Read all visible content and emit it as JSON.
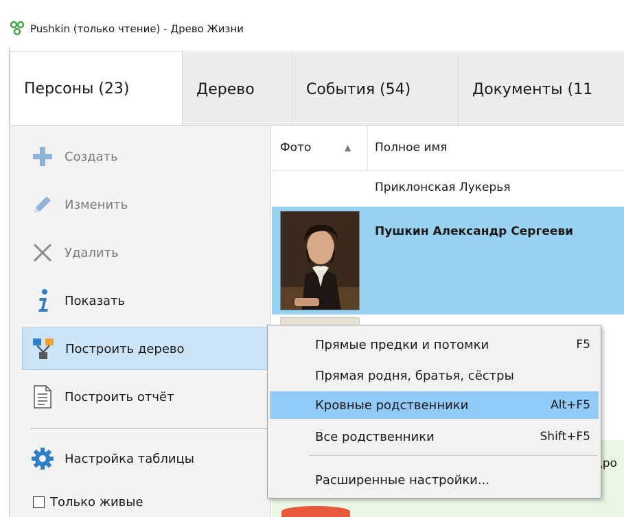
{
  "window": {
    "title": "Pushkin (только чтение) - Древо Жизни"
  },
  "tabs": [
    {
      "label": "Персоны (23)"
    },
    {
      "label": "Дерево"
    },
    {
      "label": "События (54)"
    },
    {
      "label": "Документы (11"
    }
  ],
  "sidebar": {
    "items": [
      {
        "label": "Создать",
        "icon": "plus-icon",
        "enabled": false
      },
      {
        "label": "Изменить",
        "icon": "pencil-icon",
        "enabled": false
      },
      {
        "label": "Удалить",
        "icon": "x-icon",
        "enabled": false
      },
      {
        "label": "Показать",
        "icon": "info-icon",
        "enabled": true
      },
      {
        "label": "Построить дерево",
        "icon": "tree-icon",
        "enabled": true
      },
      {
        "label": "Построить отчёт",
        "icon": "document-icon",
        "enabled": true
      },
      {
        "label": "Настройка таблицы",
        "icon": "gear-icon",
        "enabled": true
      }
    ],
    "only_living_label": "Только живые",
    "only_living_checked": false
  },
  "grid": {
    "columns": [
      {
        "label": "Фото",
        "sort": "asc"
      },
      {
        "label": "Полное имя"
      }
    ],
    "rows": [
      {
        "name": "Приклонская Лукерья"
      },
      {
        "name": "Пушкин Александр Сергееви",
        "selected": true
      },
      {
        "name": ""
      }
    ],
    "bottom_row_partial": "дро"
  },
  "context_menu": {
    "items": [
      {
        "label": "Прямые предки и потомки",
        "shortcut": "F5"
      },
      {
        "label": "Прямая родня, братья, сёстры",
        "shortcut": ""
      },
      {
        "label": "Кровные родственники",
        "shortcut": "Alt+F5",
        "highlighted": true
      },
      {
        "label": "Все родственники",
        "shortcut": "Shift+F5"
      },
      {
        "label": "Расширенные настройки...",
        "shortcut": ""
      }
    ]
  },
  "colors": {
    "selection_row": "#99d1f0",
    "menu_highlight": "#91c9f7",
    "sidebar_highlight": "#cce4f7",
    "accent_blue": "#2f7fc7",
    "app_icon_green": "#3fa63f"
  }
}
